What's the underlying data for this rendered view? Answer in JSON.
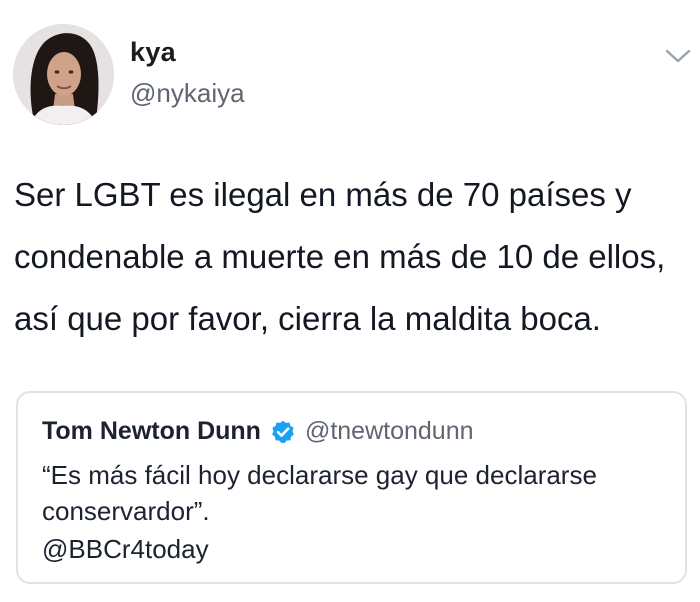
{
  "author": {
    "name": "kya",
    "handle": "@nykaiya",
    "avatar_icon": "profile-photo"
  },
  "tweet": {
    "lines": [
      "Ser LGBT es ilegal en más de 70 países y",
      "condenable a muerte en más de 10 de ellos,",
      "así que por favor, cierra la maldita boca."
    ]
  },
  "menu_icon": "chevron-down",
  "quote": {
    "name": "Tom Newton Dunn",
    "verified_icon": "verified-badge",
    "handle": "@tnewtondunn",
    "text_lines": [
      "“Es más fácil hoy declararse gay que declararse",
      "conservardor”."
    ],
    "source": "@BBCr4today"
  },
  "colors": {
    "text": "#141823",
    "secondary_text": "#5f6670",
    "verified": "#1da1f2",
    "card_border": "#dfe3e8"
  }
}
